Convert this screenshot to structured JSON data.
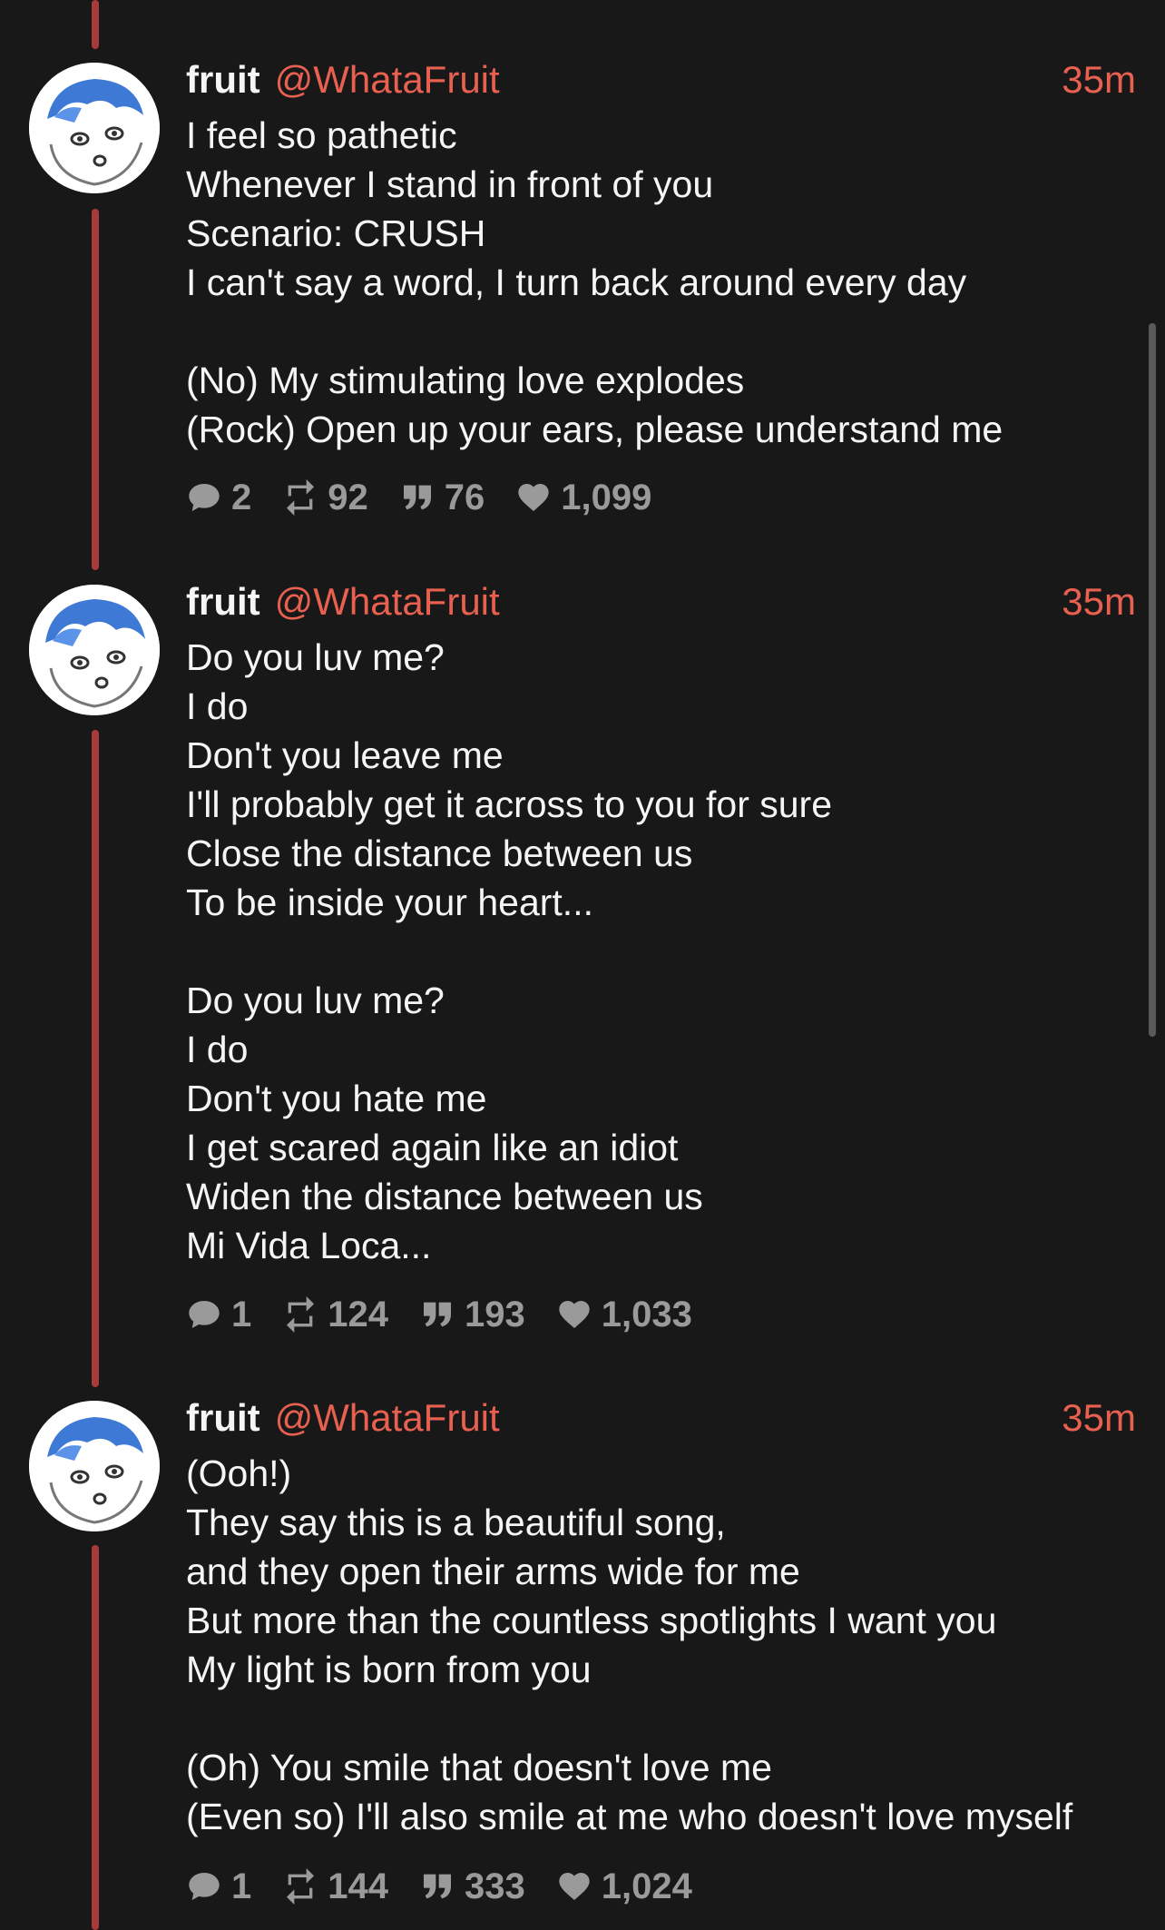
{
  "tweets": [
    {
      "name": "fruit",
      "handle": "@WhataFruit",
      "time": "35m",
      "text": "I feel so pathetic\nWhenever I stand in front of you\nScenario: CRUSH\nI can't say a word, I turn back around every day\n\n(No) My stimulating love explodes\n(Rock) Open up your ears, please understand me",
      "replies": "2",
      "retweets": "92",
      "quotes": "76",
      "likes": "1,099"
    },
    {
      "name": "fruit",
      "handle": "@WhataFruit",
      "time": "35m",
      "text": "Do you luv me?\nI do\nDon't you leave me\nI'll probably get it across to you for sure\nClose the distance between us\nTo be inside your heart...\n\nDo you luv me?\nI do\nDon't you hate me\nI get scared again like an idiot\nWiden the distance between us\nMi Vida Loca...",
      "replies": "1",
      "retweets": "124",
      "quotes": "193",
      "likes": "1,033"
    },
    {
      "name": "fruit",
      "handle": "@WhataFruit",
      "time": "35m",
      "text": "(Ooh!)\nThey say this is a beautiful song,\nand they open their arms wide for me\nBut more than the countless spotlights I want you\nMy light is born from you\n\n(Oh) You smile that doesn't love me\n(Even so) I'll also smile at me who doesn't love myself",
      "replies": "1",
      "retweets": "144",
      "quotes": "333",
      "likes": "1,024"
    }
  ],
  "colors": {
    "background": "#181818",
    "accent": "#e8604f",
    "thread_line": "#a93a3a",
    "meta_text": "#9a9a9a"
  },
  "icons": {
    "reply": "speech-bubble-icon",
    "retweet": "retweet-icon",
    "quote": "quote-icon",
    "like": "heart-icon"
  }
}
